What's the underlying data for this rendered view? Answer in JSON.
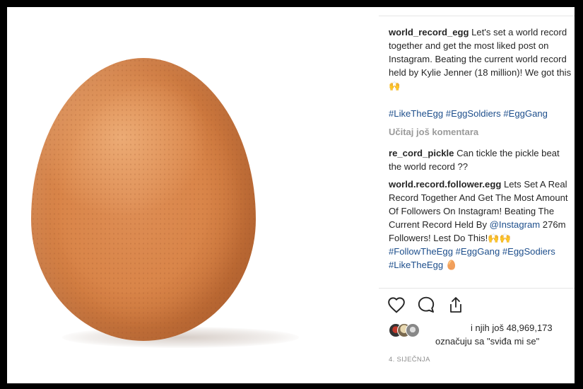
{
  "post": {
    "username": "world_record_egg",
    "caption": " Let's set a world record together and get the most liked post on Instagram. Beating the current world record held by Kylie Jenner (18 million)! We got this 🙌",
    "hashtags": "#LikeTheEgg #EggSoldiers #EggGang",
    "load_more_label": "Učitaj još komentara",
    "comments": [
      {
        "username": "re_cord_pickle",
        "text": " Can tickle the pickle beat the world record ??"
      },
      {
        "username": "world.record.follower.egg",
        "text_part1": " Lets Set A Real Record Together And Get The Most Amount Of Followers On Instagram! Beating The Current Record Held By ",
        "mention": "@Instagram",
        "text_part2": " 276m Followers! Lest Do This!🙌🙌 ",
        "tags": "#FollowTheEgg #EggGang #EggSodiers #LikeTheEgg",
        "text_part3": " 🥚"
      }
    ],
    "likes_line1": "i njih još 48,969,173",
    "likes_line2": "označuju sa \"sviđa mi se\"",
    "date": "4. SIJEČNJA"
  },
  "icons": {
    "like": "heart-icon",
    "comment": "comment-bubble-icon",
    "share": "share-upload-icon"
  },
  "colors": {
    "hashtag": "#1e4f8c",
    "text": "#262626",
    "muted": "#9a9a9a",
    "egg": "#d98549"
  }
}
